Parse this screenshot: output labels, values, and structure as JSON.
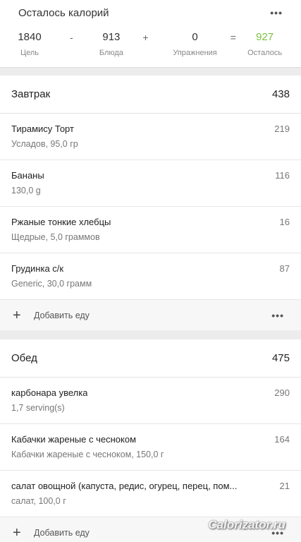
{
  "summary": {
    "title": "Осталось калорий",
    "goal": {
      "value": "1840",
      "label": "Цель"
    },
    "op_minus": "-",
    "food": {
      "value": "913",
      "label": "Блюда"
    },
    "op_plus": "+",
    "exercise": {
      "value": "0",
      "label": "Упражнения"
    },
    "op_equals": "=",
    "remaining": {
      "value": "927",
      "label": "Осталось"
    }
  },
  "menu_dots": "•••",
  "meals": [
    {
      "name": "Завтрак",
      "total": "438",
      "items": [
        {
          "name": "Тирамису Торт",
          "desc": "Усладов, 95,0 гр",
          "cal": "219"
        },
        {
          "name": "Бананы",
          "desc": "130,0 g",
          "cal": "116"
        },
        {
          "name": "Ржаные тонкие хлебцы",
          "desc": "Щедрые, 5,0 граммов",
          "cal": "16"
        },
        {
          "name": "Грудинка с/к",
          "desc": "Generic, 30,0 грамм",
          "cal": "87"
        }
      ],
      "add_label": "Добавить еду"
    },
    {
      "name": "Обед",
      "total": "475",
      "items": [
        {
          "name": "карбонара увелка",
          "desc": "1,7 serving(s)",
          "cal": "290"
        },
        {
          "name": "Кабачки жареные с чесноком",
          "desc": "Кабачки жареные с чесноком, 150,0 г",
          "cal": "164"
        },
        {
          "name": "салат овощной (капуста, редис, огурец, перец, пом...",
          "desc": "салат, 100,0 г",
          "cal": "21"
        }
      ],
      "add_label": "Добавить еду"
    }
  ],
  "icons": {
    "plus": "plus-icon",
    "more": "more-dots-icon"
  },
  "colors": {
    "remaining": "#7cc242"
  },
  "watermark": "Calorizator.ru"
}
